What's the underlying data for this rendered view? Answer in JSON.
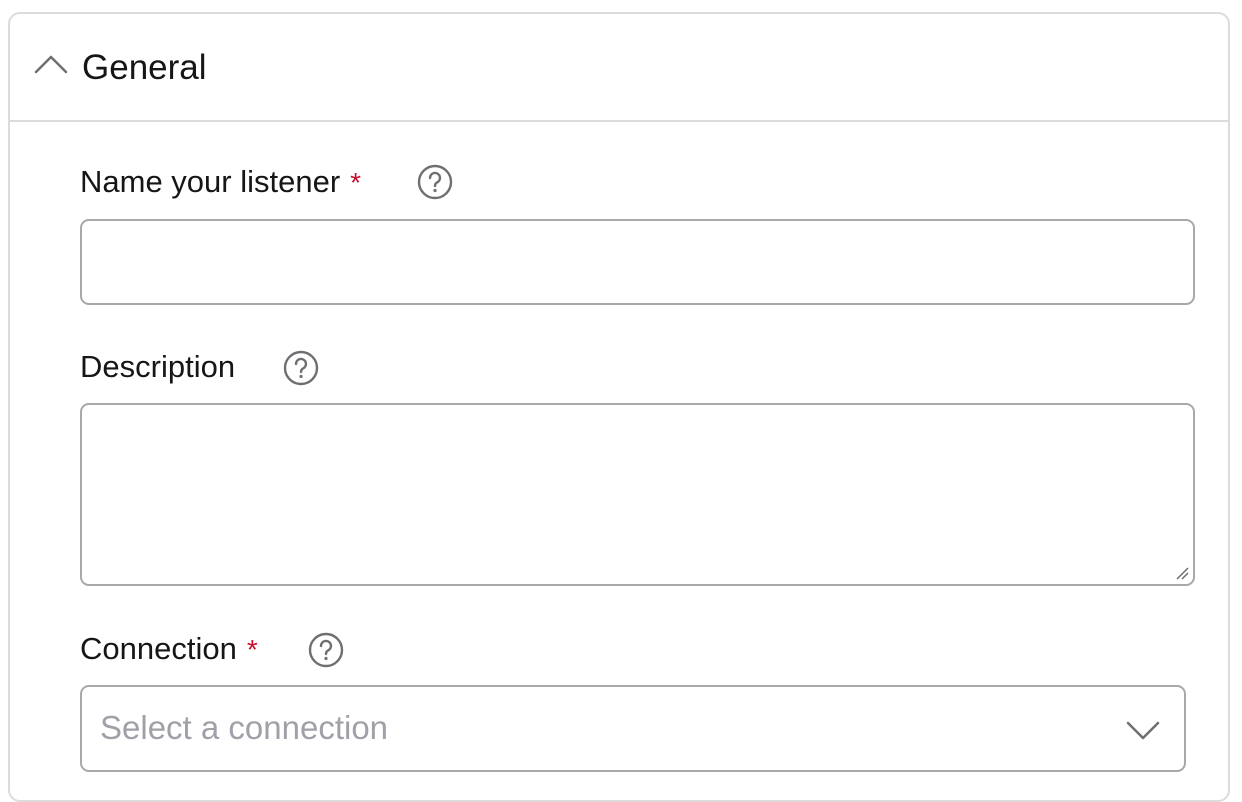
{
  "section": {
    "title": "General",
    "expanded": true,
    "toggle_icon": "chevron-up-icon"
  },
  "fields": {
    "name": {
      "label": "Name your listener",
      "required_mark": "*",
      "help_icon": "question-circle-icon",
      "value": ""
    },
    "description": {
      "label": "Description",
      "help_icon": "question-circle-icon",
      "value": ""
    },
    "connection": {
      "label": "Connection",
      "required_mark": "*",
      "help_icon": "question-circle-icon",
      "placeholder": "Select a connection",
      "dropdown_icon": "chevron-down-icon"
    }
  },
  "colors": {
    "required": "#c8102e",
    "border": "#a8a8a8",
    "panel_border": "#dcdcdc",
    "placeholder": "#a0a0a8",
    "icon": "#6f6f73"
  }
}
